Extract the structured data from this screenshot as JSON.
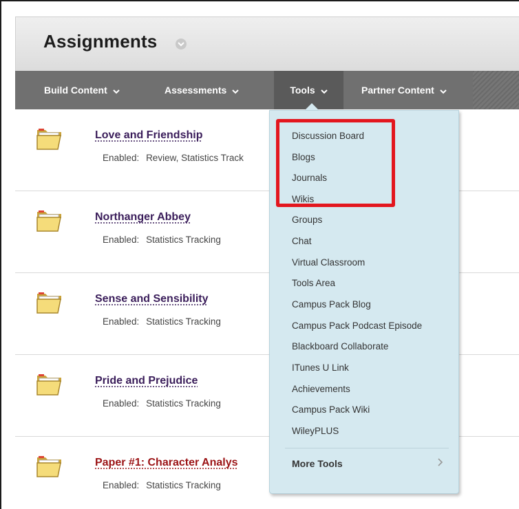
{
  "page": {
    "title": "Assignments"
  },
  "menubar": {
    "items": [
      {
        "label": "Build Content"
      },
      {
        "label": "Assessments"
      },
      {
        "label": "Tools"
      },
      {
        "label": "Partner Content"
      }
    ]
  },
  "content": {
    "enabled_label": "Enabled:",
    "items": [
      {
        "title": "Love and Friendship",
        "enabled": "Review, Statistics Track"
      },
      {
        "title": "Northanger Abbey",
        "enabled": "Statistics Tracking"
      },
      {
        "title": "Sense and Sensibility",
        "enabled": "Statistics Tracking"
      },
      {
        "title": "Pride and Prejudice",
        "enabled": "Statistics Tracking"
      },
      {
        "title": "Paper #1: Character Analys",
        "enabled": "Statistics Tracking"
      }
    ]
  },
  "tools_menu": {
    "items": [
      "Discussion Board",
      "Blogs",
      "Journals",
      "Wikis",
      "Groups",
      "Chat",
      "Virtual Classroom",
      "Tools Area",
      "Campus Pack Blog",
      "Campus Pack Podcast Episode",
      "Blackboard Collaborate",
      "ITunes U Link",
      "Achievements",
      "Campus Pack Wiki",
      "WileyPLUS"
    ],
    "more_label": "More Tools"
  },
  "colors": {
    "menubar": "#707070",
    "dropdown": "#d5e9f0",
    "highlight": "#e3161e",
    "title_link": "#3a1d5a",
    "title_link_alt": "#9b1214"
  },
  "icons": [
    "folder-icon",
    "chevron-down-icon",
    "chevron-right-icon"
  ]
}
